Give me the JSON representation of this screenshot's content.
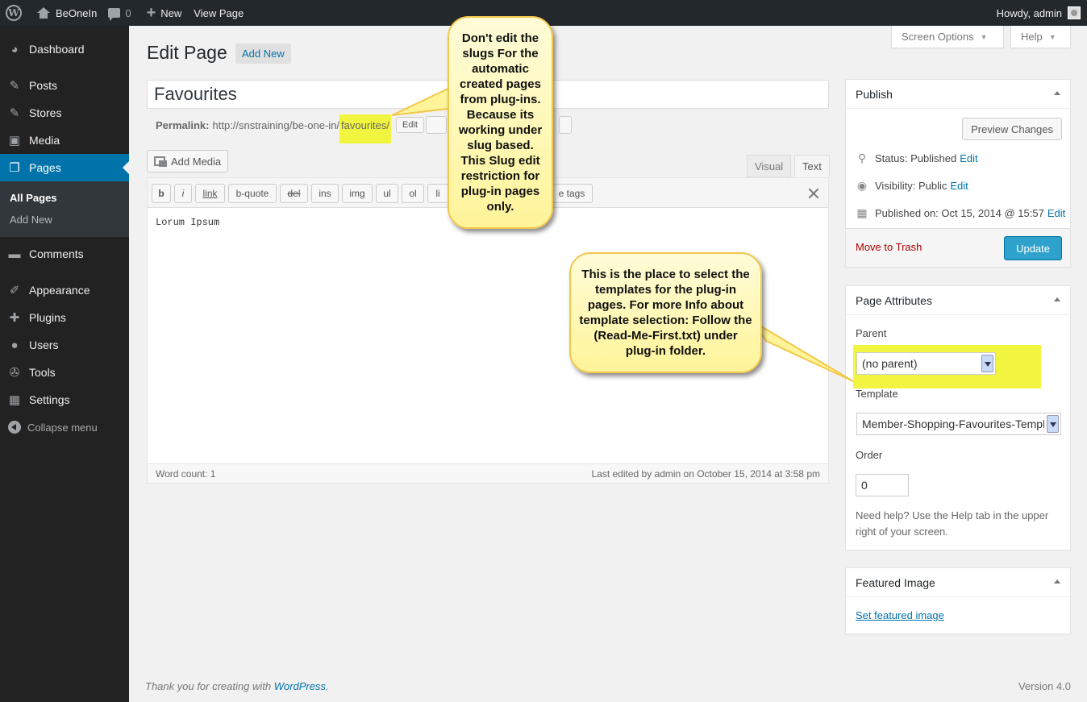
{
  "adminbar": {
    "site_name": "BeOneIn",
    "comments_count": "0",
    "new_label": "New",
    "view_page": "View Page",
    "howdy": "Howdy, admin"
  },
  "menu": {
    "items": [
      {
        "label": "Dashboard",
        "icon": "dashboard-icon"
      },
      {
        "label": "Posts",
        "icon": "pin-icon"
      },
      {
        "label": "Stores",
        "icon": "pin-icon"
      },
      {
        "label": "Media",
        "icon": "media-icon"
      },
      {
        "label": "Pages",
        "icon": "pages-icon"
      },
      {
        "label": "Comments",
        "icon": "comment-icon"
      },
      {
        "label": "Appearance",
        "icon": "brush-icon"
      },
      {
        "label": "Plugins",
        "icon": "plugin-icon"
      },
      {
        "label": "Users",
        "icon": "user-icon"
      },
      {
        "label": "Tools",
        "icon": "wrench-icon"
      },
      {
        "label": "Settings",
        "icon": "settings-icon"
      }
    ],
    "submenu": [
      "All Pages",
      "Add New"
    ],
    "collapse": "Collapse menu"
  },
  "screen_options": "Screen Options",
  "help": "Help",
  "page_title": "Edit Page",
  "add_new": "Add New",
  "post_title": "Favourites",
  "permalink": {
    "label": "Permalink:",
    "base": "http://snstraining/be-one-in/",
    "slug": "favourites/",
    "edit": "Edit"
  },
  "editor": {
    "add_media": "Add Media",
    "tab_visual": "Visual",
    "tab_text": "Text",
    "qt_buttons": [
      "b",
      "i",
      "link",
      "b-quote",
      "del",
      "ins",
      "img",
      "ul",
      "ol",
      "li",
      "e tags"
    ],
    "content": "Lorum Ipsum",
    "word_count": "Word count: 1",
    "last_edited": "Last edited by admin on October 15, 2014 at 3:58 pm"
  },
  "publish": {
    "title": "Publish",
    "preview": "Preview Changes",
    "status_label": "Status:",
    "status_value": "Published",
    "visibility_label": "Visibility:",
    "visibility_value": "Public",
    "published_label": "Published on:",
    "published_value": "Oct 15, 2014 @ 15:57",
    "edit": "Edit",
    "trash": "Move to Trash",
    "update": "Update"
  },
  "page_attributes": {
    "title": "Page Attributes",
    "parent_label": "Parent",
    "parent_value": "(no parent)",
    "template_label": "Template",
    "template_value": "Member-Shopping-Favourites-Template",
    "order_label": "Order",
    "order_value": "0",
    "help": "Need help? Use the Help tab in the upper right of your screen."
  },
  "featured_image": {
    "title": "Featured Image",
    "link": "Set featured image"
  },
  "footer": {
    "thanks_prefix": "Thank you for creating with",
    "wordpress": "WordPress",
    "period": ".",
    "version": "Version 4.0"
  },
  "callouts": {
    "slug_note": "Don't edit the slugs For the automatic created pages from plug-ins. Because its working under slug based. This Slug edit restriction for plug-in pages only.",
    "template_note": "This is the place to select the templates for the plug-in pages. For more Info about template selection: Follow the (Read-Me-First.txt) under plug-in folder."
  },
  "colors": {
    "admin_bar": "#23282d",
    "menu_bg": "#222222",
    "menu_current": "#0073aa",
    "highlight": "#f2f540",
    "update_button": "#2ea2cc",
    "callout_fill": "#fff49a",
    "callout_border": "#f2c84b"
  }
}
